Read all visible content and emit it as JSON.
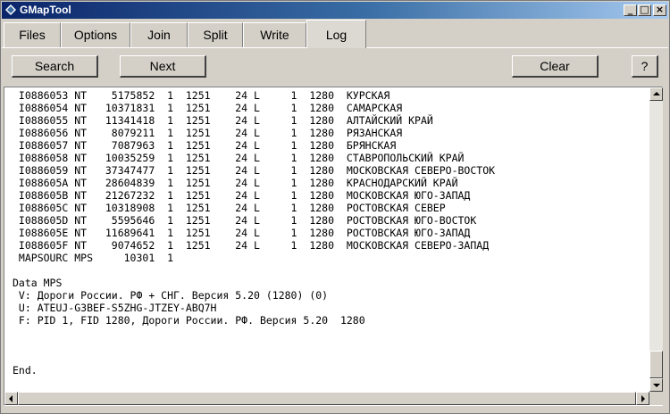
{
  "window": {
    "title": "GMapTool"
  },
  "titlebar_buttons": {
    "minimize": "_",
    "maximize": "□",
    "close": "×"
  },
  "tabs": [
    {
      "label": "Files",
      "active": false
    },
    {
      "label": "Options",
      "active": false
    },
    {
      "label": "Join",
      "active": false
    },
    {
      "label": "Split",
      "active": false
    },
    {
      "label": "Write",
      "active": false
    },
    {
      "label": "Log",
      "active": true
    }
  ],
  "toolbar": {
    "search_label": "Search",
    "next_label": "Next",
    "clear_label": "Clear",
    "help_label": "?"
  },
  "log": {
    "lines": [
      " I0886053 NT    5175852  1  1251    24 L     1  1280  КУРСКАЯ",
      " I0886054 NT   10371831  1  1251    24 L     1  1280  САМАРСКАЯ",
      " I0886055 NT   11341418  1  1251    24 L     1  1280  АЛТАЙСКИЙ КРАЙ",
      " I0886056 NT    8079211  1  1251    24 L     1  1280  РЯЗАНСКАЯ",
      " I0886057 NT    7087963  1  1251    24 L     1  1280  БРЯНСКАЯ",
      " I0886058 NT   10035259  1  1251    24 L     1  1280  СТАВРОПОЛЬСКИЙ КРАЙ",
      " I0886059 NT   37347477  1  1251    24 L     1  1280  МОСКОВСКАЯ СЕВЕРО-ВОСТОК",
      " I088605A NT   28604839  1  1251    24 L     1  1280  КРАСНОДАРСКИЙ КРАЙ",
      " I088605B NT   21267232  1  1251    24 L     1  1280  МОСКОВСКАЯ ЮГО-ЗАПАД",
      " I088605C NT   10318908  1  1251    24 L     1  1280  РОСТОВСКАЯ СЕВЕР",
      " I088605D NT    5595646  1  1251    24 L     1  1280  РОСТОВСКАЯ ЮГО-ВОСТОК",
      " I088605E NT   11689641  1  1251    24 L     1  1280  РОСТОВСКАЯ ЮГО-ЗАПАД",
      " I088605F NT    9074652  1  1251    24 L     1  1280  МОСКОВСКАЯ СЕВЕРО-ЗАПАД",
      " MAPSOURC MPS     10301  1",
      "",
      "Data MPS",
      " V: Дороги России. РФ + СНГ. Версия 5.20 (1280) (0)",
      " U: ATEUJ-G3BEF-S5ZHG-JTZEY-ABQ7H",
      " F: PID 1, FID 1280, Дороги России. РФ. Версия 5.20  1280",
      "",
      "",
      "",
      "End."
    ]
  }
}
